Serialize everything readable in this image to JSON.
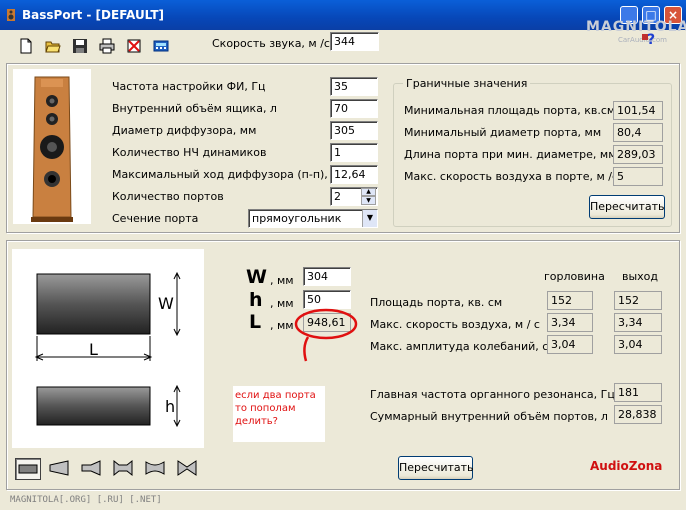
{
  "window": {
    "title": "BassPort - [DEFAULT]"
  },
  "watermark": {
    "line1": "MAGNITOLA",
    "line2": "CarAudio.com"
  },
  "toolbar": {
    "sound_speed_label": "Скорость звука, м /с",
    "sound_speed_value": "344",
    "icons": [
      "new-document-icon",
      "open-folder-icon",
      "save-icon",
      "print-icon",
      "delete-icon",
      "calculator-icon"
    ]
  },
  "params": {
    "rows": [
      {
        "label": "Частота настройки ФИ, Гц",
        "value": "35"
      },
      {
        "label": "Внутренний объём ящика, л",
        "value": "70"
      },
      {
        "label": "Диаметр диффузора, мм",
        "value": "305"
      },
      {
        "label": "Количество НЧ динамиков",
        "value": "1"
      },
      {
        "label": "Максимальный ход диффузора (п-п), мм",
        "value": "12,64"
      },
      {
        "label": "Количество портов",
        "value": "2"
      },
      {
        "label": "Сечение порта",
        "value": "прямоугольник"
      }
    ]
  },
  "limits": {
    "title": "Граничные значения",
    "rows": [
      {
        "label": "Минимальная площадь порта, кв.см.",
        "value": "101,54"
      },
      {
        "label": "Минимальный диаметр порта, мм",
        "value": "80,4"
      },
      {
        "label": "Длина порта при мин. диаметре, мм",
        "value": "289,03"
      },
      {
        "label": "Макс. скорость воздуха в порте, м /с",
        "value": "5"
      }
    ],
    "recalc_label": "Пересчитать"
  },
  "dims": {
    "w_letter": "W",
    "h_letter": "h",
    "l_letter": "L",
    "unit": ", мм",
    "w_value": "304",
    "h_value": "50",
    "l_value": "948,61",
    "diagram_w": "W",
    "diagram_l": "L",
    "diagram_h": "h"
  },
  "results": {
    "col_throat": "горловина",
    "col_exit": "выход",
    "rows": [
      {
        "label": "Площадь порта, кв. см",
        "throat": "152",
        "exit": "152"
      },
      {
        "label": "Макс. скорость воздуха, м / с",
        "throat": "3,34",
        "exit": "3,34"
      },
      {
        "label": "Макс. амплитуда колебаний, см",
        "throat": "3,04",
        "exit": "3,04"
      }
    ],
    "organ_label": "Главная частота органного резонанса, Гц",
    "organ_value": "181",
    "volume_label": "Суммарный внутренний объём портов, л",
    "volume_value": "28,838",
    "recalc_label": "Пересчитать"
  },
  "note": {
    "text": "если два порта то пополам делить?"
  },
  "brand": {
    "text": "AudioZona",
    "color": "#d01010"
  },
  "statusbar": {
    "text": "MAGNITOLA[.ORG] [.RU] [.NET]"
  },
  "annotation_color": "#e01010"
}
